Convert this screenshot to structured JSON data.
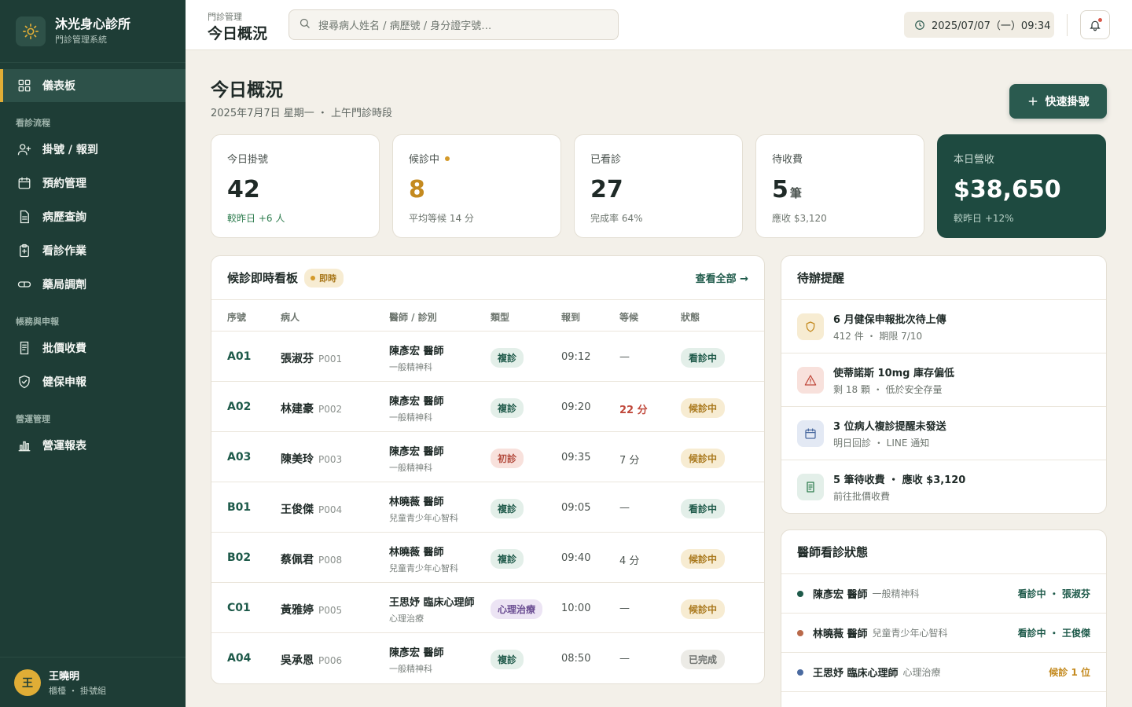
{
  "app": {
    "name": "沐光身心診所",
    "subtitle": "門診管理系統"
  },
  "sidebar": {
    "active": {
      "label": "儀表板",
      "icon": "grid-icon"
    },
    "sections": [
      {
        "title": "看診流程",
        "items": [
          {
            "label": "掛號 / 報到",
            "icon": "user-plus-icon"
          },
          {
            "label": "預約管理",
            "icon": "calendar-icon"
          },
          {
            "label": "病歷查詢",
            "icon": "document-icon"
          },
          {
            "label": "看診作業",
            "icon": "clipboard-icon"
          },
          {
            "label": "藥局調劑",
            "icon": "pill-icon"
          }
        ]
      },
      {
        "title": "帳務與申報",
        "items": [
          {
            "label": "批價收費",
            "icon": "receipt-icon"
          },
          {
            "label": "健保申報",
            "icon": "shield-check-icon"
          }
        ]
      },
      {
        "title": "營運管理",
        "items": [
          {
            "label": "營運報表",
            "icon": "bar-chart-icon"
          }
        ]
      }
    ],
    "user": {
      "avatar": "王",
      "name": "王曉明",
      "role": "櫃檯 ・ 掛號組"
    }
  },
  "topbar": {
    "breadcrumb": "門診管理",
    "title": "今日概況",
    "search_placeholder": "搜尋病人姓名 / 病歷號 / 身分證字號…",
    "datetime": "2025/07/07（一）09:34"
  },
  "page": {
    "title": "今日概況",
    "subtitle": "2025年7月7日 星期一 ・ 上午門診時段",
    "quick_button": "快速掛號"
  },
  "stats": [
    {
      "label": "今日掛號",
      "value": "42",
      "unit": "",
      "note": "較昨日 +6 人",
      "note_color": "#2e7d4f",
      "value_color": "#1f2a27"
    },
    {
      "label": "候診中",
      "value": "8",
      "unit": "",
      "note": "平均等候 14 分",
      "note_color": "#6e766f",
      "value_color": "#c48a1f"
    },
    {
      "label": "已看診",
      "value": "27",
      "unit": "",
      "note": "完成率 64%",
      "note_color": "#6e766f",
      "value_color": "#1f2a27"
    },
    {
      "label": "待收費",
      "value": "5",
      "unit": "筆",
      "note": "應收 $3,120",
      "note_color": "#6e766f",
      "value_color": "#1f2a27"
    },
    {
      "label": "本日營收",
      "value": "$38,650",
      "unit": "",
      "note": "較昨日 +12%",
      "note_color": "#b9d2c8",
      "value_color": "#ffffff"
    }
  ],
  "queue": {
    "title": "候診即時看板",
    "badge": "即時",
    "view_all": "查看全部 →",
    "columns": [
      "序號",
      "病人",
      "醫師 / 診別",
      "類型",
      "報到",
      "等候",
      "狀態"
    ],
    "rows": [
      {
        "seq": "A01",
        "name": "張淑芬",
        "pid": "P001",
        "doctor": "陳彥宏 醫師",
        "dept": "一般精神科",
        "type": "複診",
        "type_kind": "revisit",
        "arrive": "09:12",
        "wait": "—",
        "wait_warn": false,
        "status": "看診中",
        "status_kind": "in"
      },
      {
        "seq": "A02",
        "name": "林建豪",
        "pid": "P002",
        "doctor": "陳彥宏 醫師",
        "dept": "一般精神科",
        "type": "複診",
        "type_kind": "revisit",
        "arrive": "09:20",
        "wait": "22 分",
        "wait_warn": true,
        "status": "候診中",
        "status_kind": "wait"
      },
      {
        "seq": "A03",
        "name": "陳美玲",
        "pid": "P003",
        "doctor": "陳彥宏 醫師",
        "dept": "一般精神科",
        "type": "初診",
        "type_kind": "first",
        "arrive": "09:35",
        "wait": "7 分",
        "wait_warn": false,
        "status": "候診中",
        "status_kind": "wait"
      },
      {
        "seq": "B01",
        "name": "王俊傑",
        "pid": "P004",
        "doctor": "林曉薇 醫師",
        "dept": "兒童青少年心智科",
        "type": "複診",
        "type_kind": "revisit",
        "arrive": "09:05",
        "wait": "—",
        "wait_warn": false,
        "status": "看診中",
        "status_kind": "in"
      },
      {
        "seq": "B02",
        "name": "蔡佩君",
        "pid": "P008",
        "doctor": "林曉薇 醫師",
        "dept": "兒童青少年心智科",
        "type": "複診",
        "type_kind": "revisit",
        "arrive": "09:40",
        "wait": "4 分",
        "wait_warn": false,
        "status": "候診中",
        "status_kind": "wait"
      },
      {
        "seq": "C01",
        "name": "黃雅婷",
        "pid": "P005",
        "doctor": "王思妤 臨床心理師",
        "dept": "心理治療",
        "type": "心理治療",
        "type_kind": "psy",
        "arrive": "10:00",
        "wait": "—",
        "wait_warn": false,
        "status": "候診中",
        "status_kind": "wait"
      },
      {
        "seq": "A04",
        "name": "吳承恩",
        "pid": "P006",
        "doctor": "陳彥宏 醫師",
        "dept": "一般精神科",
        "type": "複診",
        "type_kind": "revisit",
        "arrive": "08:50",
        "wait": "—",
        "wait_warn": false,
        "status": "已完成",
        "status_kind": "done"
      }
    ]
  },
  "todos": {
    "title": "待辦提醒",
    "items": [
      {
        "title": "6 月健保申報批次待上傳",
        "sub": "412 件 ・ 期限 7/10",
        "icon": "shield-icon",
        "bg": "#f7ecd2",
        "fg": "#c48a1f"
      },
      {
        "title": "使蒂諾斯 10mg 庫存偏低",
        "sub": "剩 18 顆 ・ 低於安全存量",
        "icon": "warning-icon",
        "bg": "#f8e1dc",
        "fg": "#c0483b"
      },
      {
        "title": "3 位病人複診提醒未發送",
        "sub": "明日回診 ・ LINE 通知",
        "icon": "calendar-icon",
        "bg": "#e3e9f4",
        "fg": "#4a6aa0"
      },
      {
        "title": "5 筆待收費 ・ 應收 $3,120",
        "sub": "前往批價收費",
        "icon": "receipt-icon",
        "bg": "#e3efe9",
        "fg": "#2e7d4f"
      }
    ]
  },
  "doctors": {
    "title": "醫師看診狀態",
    "items": [
      {
        "name": "陳彥宏 醫師",
        "dept": "一般精神科",
        "status": "看診中 ・ 張淑芬",
        "dot": "#1e5a4a",
        "status_color": "#1e5a4a"
      },
      {
        "name": "林曉薇 醫師",
        "dept": "兒童青少年心智科",
        "status": "看診中 ・ 王俊傑",
        "dot": "#b9694a",
        "status_color": "#1e5a4a"
      },
      {
        "name": "王思妤 臨床心理師",
        "dept": "心理治療",
        "status": "候診 1 位",
        "dot": "#4a6aa0",
        "status_color": "#c48a1f"
      }
    ]
  }
}
